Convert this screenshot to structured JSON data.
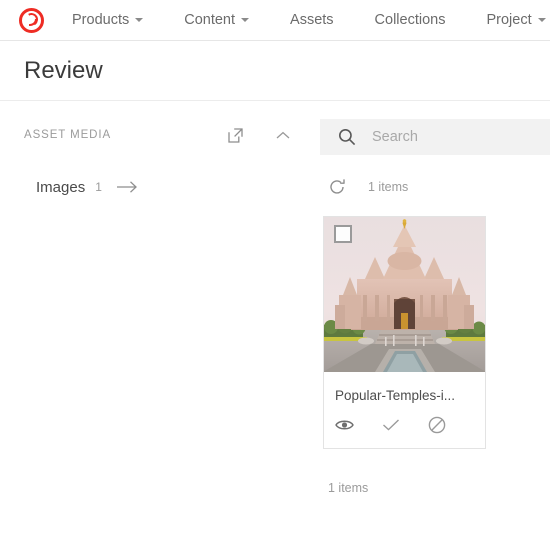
{
  "topnav": {
    "logo_name": "brand-logo",
    "logo_color": "#ee2c24",
    "items": [
      {
        "label": "Products",
        "has_caret": true
      },
      {
        "label": "Content",
        "has_caret": true
      },
      {
        "label": "Assets",
        "has_caret": false
      },
      {
        "label": "Collections",
        "has_caret": false
      },
      {
        "label": "Project",
        "has_caret": true
      }
    ]
  },
  "page": {
    "title": "Review"
  },
  "sidebar": {
    "section_label": "ASSET MEDIA",
    "open_icon": "external-link-icon",
    "collapse_icon": "chevron-up-icon",
    "rows": [
      {
        "name": "Images",
        "count": "1",
        "arrow_icon": "arrow-right-icon"
      }
    ]
  },
  "main": {
    "search": {
      "placeholder": "Search",
      "value": "",
      "icon": "search-icon"
    },
    "toolbar": {
      "refresh_icon": "refresh-icon",
      "count_label": "1 items"
    },
    "cards": [
      {
        "checkbox_checked": false,
        "thumb_alt": "hindu-temple-photo",
        "name": "Popular-Temples-i...",
        "actions": [
          {
            "icon": "eye-icon",
            "label": "Preview",
            "active": true
          },
          {
            "icon": "check-icon",
            "label": "Approve",
            "active": false
          },
          {
            "icon": "reject-icon",
            "label": "Reject",
            "active": false
          }
        ]
      }
    ],
    "footer_count_label": "1 items"
  },
  "colors": {
    "brand_red": "#ee2c24",
    "text_primary": "#3b3b3b",
    "text_muted": "#9b9b9b",
    "search_bg": "#f2f2f2",
    "border": "#e3e3e3"
  }
}
